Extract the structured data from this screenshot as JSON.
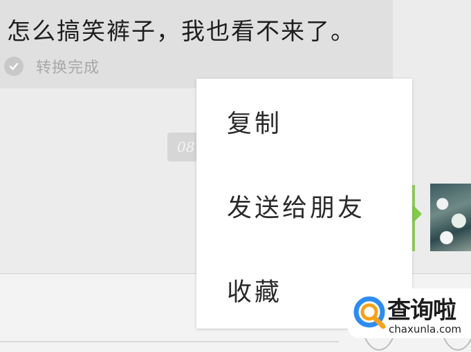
{
  "message": {
    "text": "怎么搞笑裤子，我也看不来了。",
    "status_icon": "check-icon",
    "status": "转换完成"
  },
  "timestamp_fragment": "08",
  "context_menu": {
    "items": [
      {
        "label": "复制"
      },
      {
        "label": "发送给朋友"
      },
      {
        "label": "收藏"
      }
    ]
  },
  "watermark": {
    "title": "查询啦",
    "domain": "chaxunla.com"
  },
  "colors": {
    "chat_background": "#ececec",
    "bubble": "#e0e0e0",
    "menu": "#ffffff",
    "accent_green": "#7fcb4a",
    "logo_blue": "#2d8cf0",
    "logo_orange": "#f5a21b"
  }
}
